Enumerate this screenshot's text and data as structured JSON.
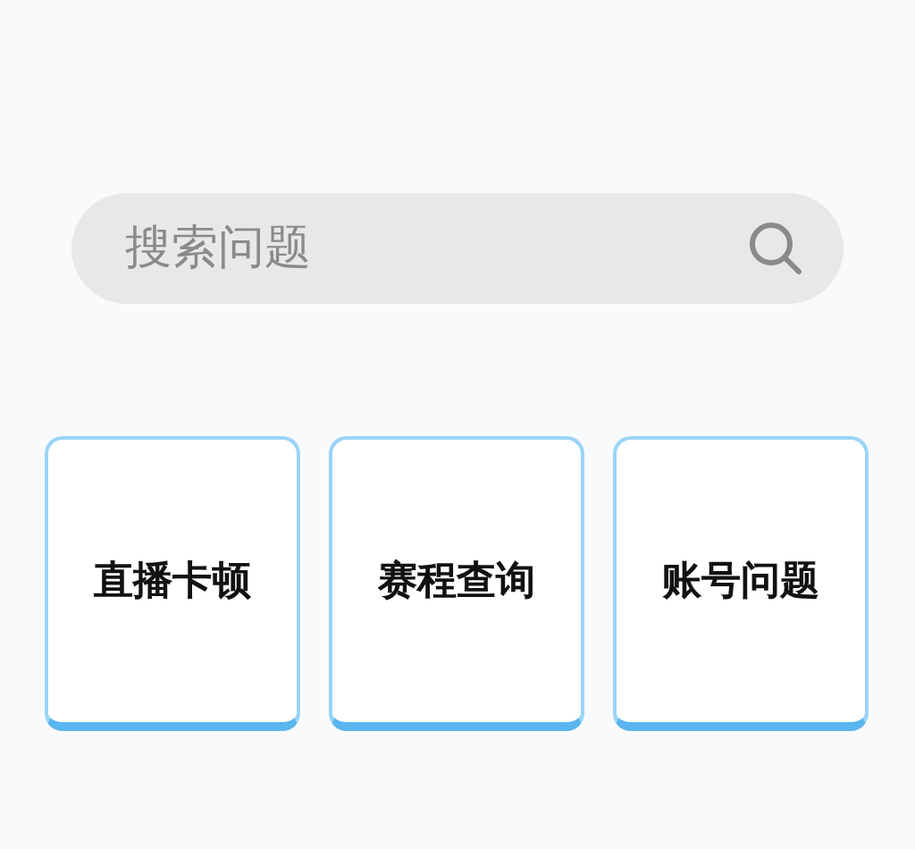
{
  "search": {
    "placeholder": "搜索问题"
  },
  "categories": [
    {
      "label": "直播卡顿"
    },
    {
      "label": "赛程查询"
    },
    {
      "label": "账号问题"
    }
  ]
}
